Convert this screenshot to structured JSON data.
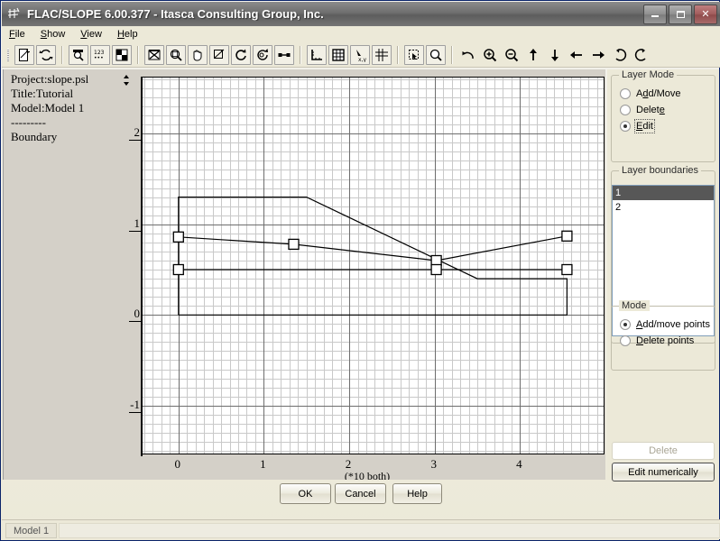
{
  "window": {
    "title": "FLAC/SLOPE 6.00.377 - Itasca Consulting Group, Inc.",
    "app_icon": "flac-slope-icon",
    "minimize_label": "Minimize",
    "maximize_label": "Maximize",
    "close_label": "Close"
  },
  "menu": {
    "items": [
      {
        "label": "File",
        "mnemonic": "F"
      },
      {
        "label": "Show",
        "mnemonic": "S"
      },
      {
        "label": "View",
        "mnemonic": "V"
      },
      {
        "label": "Help",
        "mnemonic": "H"
      }
    ]
  },
  "toolbar": {
    "groups": [
      {
        "buttons": [
          {
            "name": "new-project-icon",
            "label": "New project"
          },
          {
            "name": "refresh-icon",
            "label": "Refresh"
          }
        ]
      },
      {
        "buttons": [
          {
            "name": "magnifier-icon",
            "label": "Zoom"
          },
          {
            "name": "numbers-icon",
            "label": "Numbers"
          },
          {
            "name": "quad-grid-icon",
            "label": "Quadrants"
          }
        ]
      },
      {
        "buttons": [
          {
            "name": "close-x-icon",
            "label": "Close plot"
          },
          {
            "name": "zoom-window-icon",
            "label": "Zoom window"
          },
          {
            "name": "pan-hand-icon",
            "label": "Pan"
          },
          {
            "name": "zoom-rect-icon",
            "label": "Zoom rectangle"
          },
          {
            "name": "rotate-cw-icon",
            "label": "Rotate clockwise"
          },
          {
            "name": "rotate-view-icon",
            "label": "Rotate view"
          },
          {
            "name": "link-icon",
            "label": "Link"
          }
        ]
      },
      {
        "buttons": [
          {
            "name": "axes-icon",
            "label": "Axes"
          },
          {
            "name": "grid-icon",
            "label": "Grid"
          },
          {
            "name": "xy-points-icon",
            "label": "XY points"
          },
          {
            "name": "snap-grid-icon",
            "label": "Snap to grid"
          }
        ]
      },
      {
        "buttons": [
          {
            "name": "marquee-select-icon",
            "label": "Select region"
          },
          {
            "name": "zoom-extents-icon",
            "label": "Zoom extents"
          }
        ]
      },
      {
        "buttons": [
          {
            "name": "undo-icon",
            "label": "Undo"
          },
          {
            "name": "zoom-in-icon",
            "label": "Zoom in"
          },
          {
            "name": "zoom-out-icon",
            "label": "Zoom out"
          },
          {
            "name": "arrow-up-icon",
            "label": "Pan up"
          },
          {
            "name": "arrow-down-icon",
            "label": "Pan down"
          },
          {
            "name": "arrow-left-icon",
            "label": "Pan left"
          },
          {
            "name": "arrow-right-icon",
            "label": "Pan right"
          },
          {
            "name": "rotate-left-icon",
            "label": "Rotate left"
          },
          {
            "name": "rotate-right-icon",
            "label": "Rotate right"
          }
        ]
      }
    ]
  },
  "info_panel": {
    "lines": [
      "Project:slope.psl",
      "Title:Tutorial",
      "Model:Model 1",
      "---------",
      "Boundary"
    ]
  },
  "layer_mode": {
    "title": "Layer Mode",
    "options": [
      {
        "label": "Add/Move",
        "mnemonic": "dd",
        "selected": false
      },
      {
        "label": "Delete",
        "mnemonic": "e",
        "selected": false
      },
      {
        "label": "Edit",
        "mnemonic": "E",
        "selected": true
      }
    ]
  },
  "layer_boundaries": {
    "title": "Layer boundaries",
    "items": [
      {
        "label": "1",
        "selected": true
      },
      {
        "label": "2",
        "selected": false
      }
    ],
    "selection_color": "#575757"
  },
  "point_mode": {
    "title": "Mode",
    "options": [
      {
        "label": "Add/move points",
        "mnemonic": "A",
        "selected": true
      },
      {
        "label": "Delete points",
        "mnemonic": "D",
        "selected": false
      }
    ]
  },
  "panel_buttons": {
    "delete": {
      "label": "Delete",
      "mnemonic": "D",
      "enabled": false
    },
    "edit_numerically": {
      "label": "Edit numerically",
      "mnemonic": "E",
      "enabled": true
    }
  },
  "dialog_buttons": {
    "ok": "OK",
    "cancel": "Cancel",
    "help": "Help"
  },
  "status_bar": {
    "model": "Model 1"
  },
  "chart_data": {
    "type": "line",
    "title": "",
    "xlabel": "(*10 both)",
    "ylabel": "",
    "xlim": [
      -0.42,
      5.0
    ],
    "ylim": [
      -1.55,
      2.62
    ],
    "xticks": [
      0,
      1,
      2,
      3,
      4
    ],
    "yticks": [
      2,
      1,
      0,
      -1
    ],
    "grid": true,
    "minor_grid_step": 0.1,
    "major_grid_step": 1.0,
    "grid_color": "#c9c9c9",
    "major_grid_color": "#6e6e6e",
    "line_color": "#000000",
    "marker": "square-open",
    "series": [
      {
        "name": "model-outline",
        "closed": false,
        "points": [
          [
            0,
            0
          ],
          [
            0,
            1.3
          ],
          [
            1.5,
            1.3
          ],
          [
            3.5,
            0.4
          ],
          [
            4.55,
            0.4
          ],
          [
            4.55,
            0
          ],
          [
            0,
            0
          ]
        ]
      },
      {
        "name": "layer-boundary-1",
        "closed": false,
        "markers": true,
        "points": [
          [
            0,
            0.86
          ],
          [
            1.35,
            0.78
          ],
          [
            3.02,
            0.6
          ],
          [
            4.55,
            0.87
          ]
        ]
      },
      {
        "name": "layer-boundary-2",
        "closed": false,
        "markers": true,
        "points": [
          [
            0,
            0.5
          ],
          [
            3.02,
            0.5
          ],
          [
            4.55,
            0.5
          ]
        ]
      }
    ]
  }
}
